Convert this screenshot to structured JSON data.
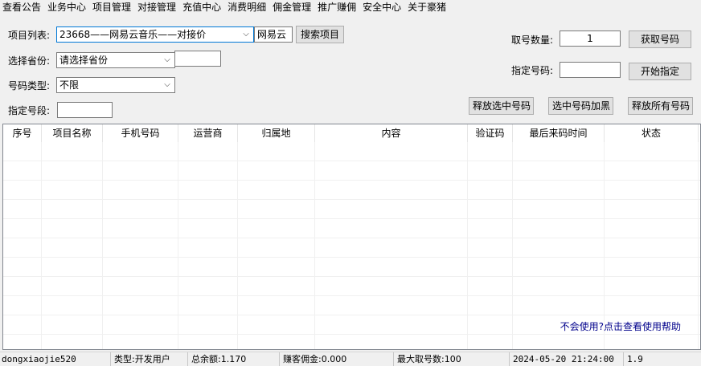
{
  "menu": [
    "查看公告",
    "业务中心",
    "项目管理",
    "对接管理",
    "充值中心",
    "消费明细",
    "佣金管理",
    "推广赚佣",
    "安全中心",
    "关于豪猪"
  ],
  "form": {
    "project_label": "项目列表:",
    "project_value": "23668——网易云音乐——对接价",
    "search_value": "网易云",
    "search_button": "搜索项目",
    "province_label": "选择省份:",
    "province_value": "请选择省份",
    "province_extra": "",
    "number_type_label": "号码类型:",
    "number_type_value": "不限",
    "segment_label": "指定号段:",
    "segment_value": "",
    "count_label": "取号数量:",
    "count_value": "1",
    "get_button": "获取号码",
    "specify_label": "指定号码:",
    "specify_value": "",
    "start_button": "开始指定",
    "release_selected": "释放选中号码",
    "blacklist_selected": "选中号码加黑",
    "release_all": "释放所有号码"
  },
  "table": {
    "columns": [
      "序号",
      "项目名称",
      "手机号码",
      "运营商",
      "归属地",
      "内容",
      "验证码",
      "最后来码时间",
      "状态"
    ],
    "rows": [],
    "help_link": "不会使用?点击查看使用帮助"
  },
  "status": {
    "user": "dongxiaojie520",
    "type": "类型:开发用户",
    "balance": "总余额:1.170",
    "commission": "赚客佣金:0.000",
    "max_take": "最大取号数:100",
    "datetime": "2024-05-20 21:24:00",
    "version": "1.9"
  }
}
